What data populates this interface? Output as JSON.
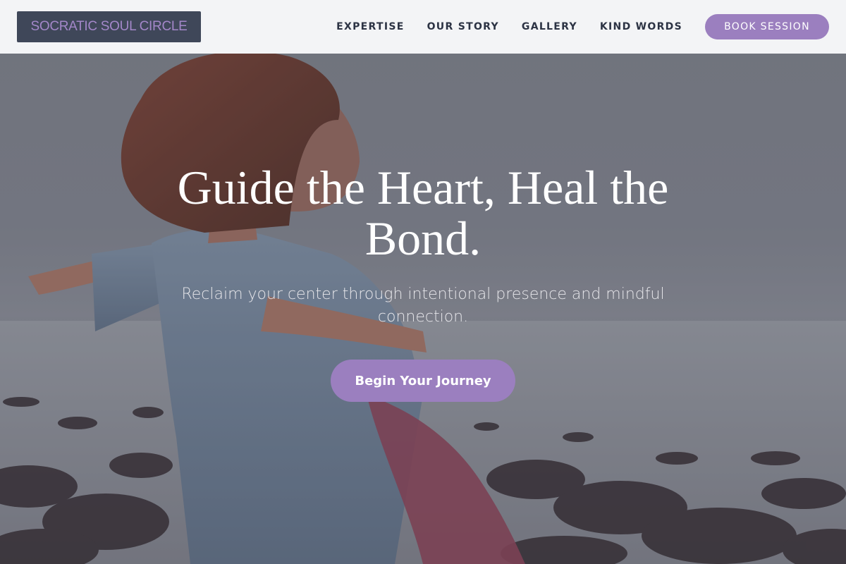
{
  "brand": {
    "name": "SOCRATIC SOUL CIRCLE"
  },
  "nav": {
    "items": [
      {
        "label": "EXPERTISE"
      },
      {
        "label": "OUR STORY"
      },
      {
        "label": "GALLERY"
      },
      {
        "label": "KIND WORDS"
      }
    ],
    "cta_label": "BOOK SESSION"
  },
  "hero": {
    "title": "Guide the Heart, Heal the Bond.",
    "subtitle": "Reclaim your center through intentional presence and mindful connection.",
    "cta_label": "Begin Your Journey",
    "image": "woman-arms-outstretched-by-sea"
  },
  "colors": {
    "accent": "#9b7fbf",
    "logo_bg": "#3f4759",
    "logo_text": "#a387c9",
    "header_bg": "#f3f4f6",
    "nav_text": "#2c3344"
  }
}
